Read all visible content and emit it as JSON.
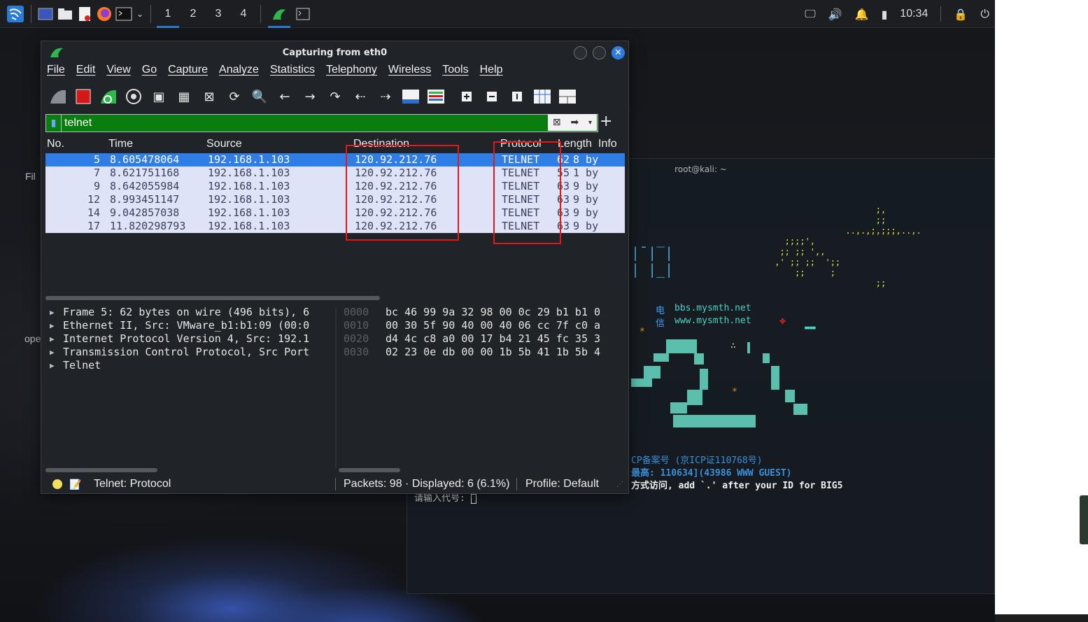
{
  "taskbar": {
    "workspaces": [
      "1",
      "2",
      "3",
      "4"
    ],
    "active_workspace": "1",
    "clock": "10:34"
  },
  "background_fragments": {
    "left_1": "Fil",
    "left_2": "ope"
  },
  "terminal": {
    "title": "root@kali: ~",
    "site1_label": "电",
    "site1": "bbs.mysmth.net",
    "site2_label": "信",
    "site2": "www.mysmth.net",
    "icp": "CP备案号 (京ICP证110768号)",
    "max_online": "最高: 110634](43986 WWW GUEST)",
    "big5_hint": "方式访问, add `.' after your ID for BIG5",
    "prompt": "请输入代号: "
  },
  "wireshark": {
    "title": "Capturing from eth0",
    "menu": [
      "File",
      "Edit",
      "View",
      "Go",
      "Capture",
      "Analyze",
      "Statistics",
      "Telephony",
      "Wireless",
      "Tools",
      "Help"
    ],
    "filter": "telnet",
    "columns": {
      "no": "No.",
      "time": "Time",
      "source": "Source",
      "destination": "Destination",
      "protocol": "Protocol",
      "length": "Length",
      "info": "Info"
    },
    "packets": [
      {
        "no": "5",
        "time": "8.605478064",
        "source": "192.168.1.103",
        "destination": "120.92.212.76",
        "protocol": "TELNET",
        "length": "62",
        "info": "8 by"
      },
      {
        "no": "7",
        "time": "8.621751168",
        "source": "192.168.1.103",
        "destination": "120.92.212.76",
        "protocol": "TELNET",
        "length": "55",
        "info": "1 by"
      },
      {
        "no": "9",
        "time": "8.642055984",
        "source": "192.168.1.103",
        "destination": "120.92.212.76",
        "protocol": "TELNET",
        "length": "63",
        "info": "9 by"
      },
      {
        "no": "12",
        "time": "8.993451147",
        "source": "192.168.1.103",
        "destination": "120.92.212.76",
        "protocol": "TELNET",
        "length": "63",
        "info": "9 by"
      },
      {
        "no": "14",
        "time": "9.042857038",
        "source": "192.168.1.103",
        "destination": "120.92.212.76",
        "protocol": "TELNET",
        "length": "63",
        "info": "9 by"
      },
      {
        "no": "17",
        "time": "11.820298793",
        "source": "192.168.1.103",
        "destination": "120.92.212.76",
        "protocol": "TELNET",
        "length": "63",
        "info": "9 by"
      }
    ],
    "details": [
      "Frame 5: 62 bytes on wire (496 bits), 6",
      "Ethernet II, Src: VMware_b1:b1:09 (00:0",
      "Internet Protocol Version 4, Src: 192.1",
      "Transmission Control Protocol, Src Port",
      "Telnet"
    ],
    "hex": [
      {
        "offset": "0000",
        "bytes": "bc 46 99 9a 32 98 00 0c  29 b1 b1 0"
      },
      {
        "offset": "0010",
        "bytes": "00 30 5f 90 40 00 40 06  cc 7f c0 a"
      },
      {
        "offset": "0020",
        "bytes": "d4 4c c8 a0 00 17 b4 21  45 fc 35 3"
      },
      {
        "offset": "0030",
        "bytes": "02 23 0e db 00 00 1b 5b  41 1b 5b 4"
      }
    ],
    "status": {
      "field": "Telnet: Protocol",
      "packets": "Packets: 98 · Displayed: 6 (6.1%)",
      "profile": "Profile: Default"
    }
  },
  "colors": {
    "selected_row": "#2f7de6",
    "row_bg": "#dfe3f7",
    "filter_ok": "#0a7d10",
    "annotation": "#e01919",
    "accent": "#2a7bd5"
  }
}
